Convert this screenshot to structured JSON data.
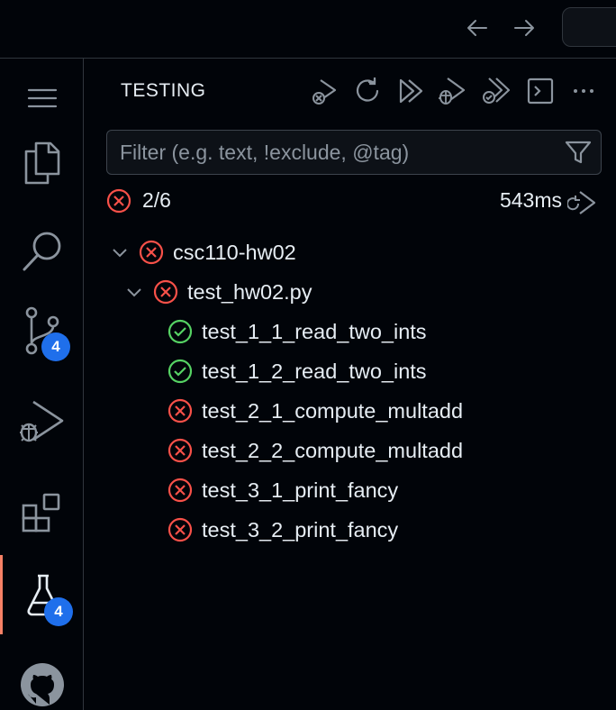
{
  "colors": {
    "background": "#010409",
    "fail": "#f85149",
    "pass": "#56d364",
    "badge": "#1f6feb",
    "active_indicator": "#f78166"
  },
  "activity_bar": {
    "items": [
      {
        "name": "menu",
        "icon": "hamburger-icon"
      },
      {
        "name": "explorer",
        "icon": "files-icon"
      },
      {
        "name": "search",
        "icon": "search-icon"
      },
      {
        "name": "source-control",
        "icon": "source-control-icon",
        "badge": "4"
      },
      {
        "name": "run-and-debug",
        "icon": "run-debug-icon"
      },
      {
        "name": "extensions",
        "icon": "extensions-icon"
      },
      {
        "name": "testing",
        "icon": "beaker-icon",
        "badge": "4",
        "active": true
      },
      {
        "name": "github",
        "icon": "github-icon"
      }
    ]
  },
  "testing": {
    "title": "TESTING",
    "filter": {
      "placeholder": "Filter (e.g. text, !exclude, @tag)",
      "value": ""
    },
    "summary": {
      "result": "2/6",
      "duration": "543ms"
    },
    "tree": {
      "workspace": "csc110-hw02",
      "file": "test_hw02.py",
      "tests": [
        {
          "name": "test_1_1_read_two_ints",
          "status": "passed"
        },
        {
          "name": "test_1_2_read_two_ints",
          "status": "passed"
        },
        {
          "name": "test_2_1_compute_multadd",
          "status": "failed"
        },
        {
          "name": "test_2_2_compute_multadd",
          "status": "failed"
        },
        {
          "name": "test_3_1_print_fancy",
          "status": "failed"
        },
        {
          "name": "test_3_2_print_fancy",
          "status": "failed"
        }
      ]
    }
  }
}
